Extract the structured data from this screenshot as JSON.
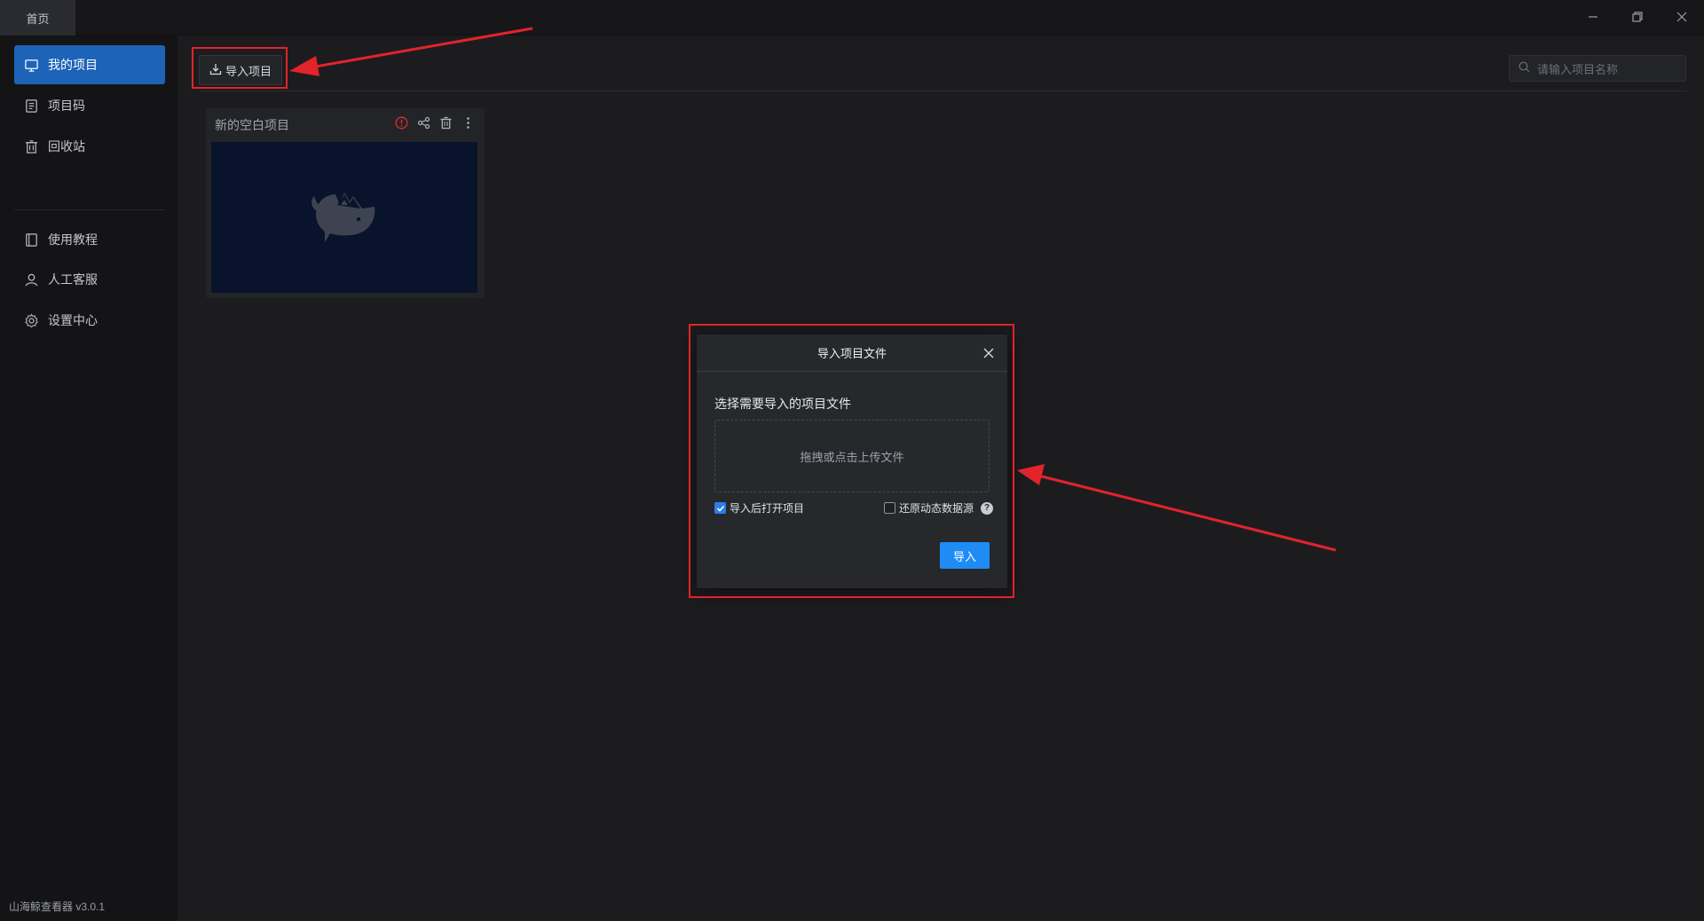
{
  "titlebar": {
    "tab_label": "首页",
    "controls": [
      "minimize-icon",
      "restore-icon",
      "close-icon"
    ]
  },
  "sidebar": {
    "items": [
      {
        "label": "我的项目",
        "icon": "project-icon",
        "active": true
      },
      {
        "label": "项目码",
        "icon": "document-icon",
        "active": false
      },
      {
        "label": "回收站",
        "icon": "trash-icon",
        "active": false
      },
      {
        "label": "使用教程",
        "icon": "book-icon",
        "active": false
      },
      {
        "label": "人工客服",
        "icon": "user-icon",
        "active": false
      },
      {
        "label": "设置中心",
        "icon": "gear-icon",
        "active": false
      }
    ],
    "version": "山海鲸查看器 v3.0.1"
  },
  "toolbar": {
    "import_label": "导入项目",
    "search_placeholder": "请输入项目名称"
  },
  "projects": [
    {
      "name": "新的空白项目",
      "icons": [
        "warning-icon",
        "share-icon",
        "delete-icon",
        "more-icon"
      ]
    }
  ],
  "dialog": {
    "title": "导入项目文件",
    "prompt": "选择需要导入的项目文件",
    "dropzone_text": "拖拽或点击上传文件",
    "option_open_after": {
      "label": "导入后打开项目",
      "checked": true
    },
    "option_restore_data": {
      "label": "还原动态数据源",
      "checked": false
    },
    "confirm_label": "导入"
  },
  "colors": {
    "accent": "#1f8cf6",
    "active_nav": "#1d63b8",
    "annotation_red": "#e3232a",
    "warning": "#e02d2d"
  }
}
